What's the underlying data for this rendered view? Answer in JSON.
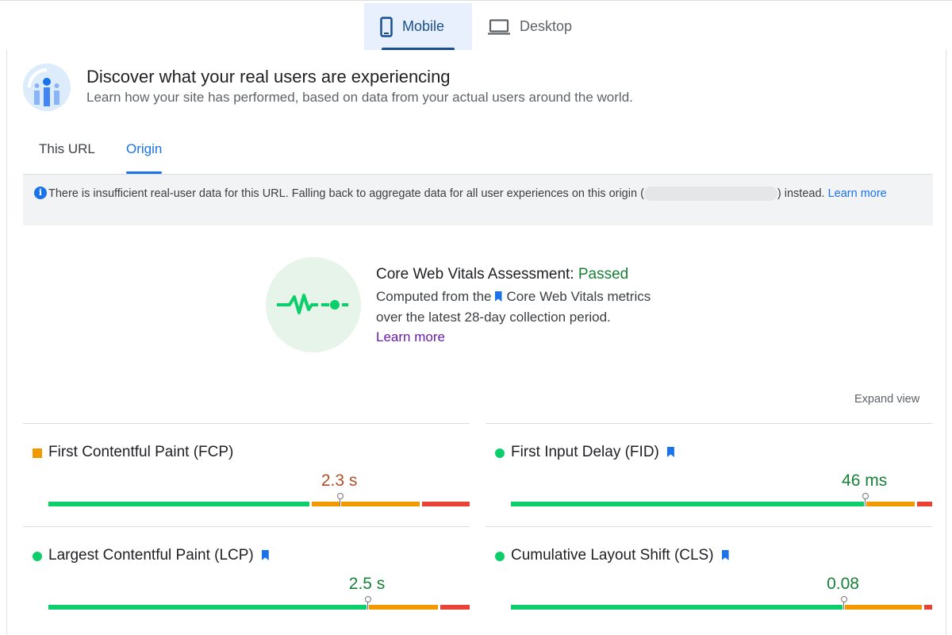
{
  "device_tabs": [
    {
      "label": "Mobile",
      "icon": "phone-icon",
      "active": true
    },
    {
      "label": "Desktop",
      "icon": "laptop-icon",
      "active": false
    }
  ],
  "hero": {
    "title": "Discover what your real users are experiencing",
    "subtitle": "Learn how your site has performed, based on data from your actual users around the world."
  },
  "scope_tabs": [
    {
      "label": "This URL",
      "active": false
    },
    {
      "label": "Origin",
      "active": true
    }
  ],
  "notice": {
    "text_before": "There is insufficient real-user data for this URL. Falling back to aggregate data for all user experiences on this origin (",
    "text_after": ") instead. ",
    "link": "Learn more"
  },
  "assessment": {
    "title": "Core Web Vitals Assessment: ",
    "status": "Passed",
    "line1_before": "Computed from the",
    "line1_after": "Core Web Vitals metrics",
    "line2": "over the latest 28-day collection period.",
    "learn_more": "Learn more"
  },
  "expand_view": "Expand view",
  "metrics": [
    {
      "key": "fcp",
      "name": "First Contentful Paint (FCP)",
      "value": "2.3 s",
      "marker": "square",
      "core_vital": false,
      "value_color": "#b0502a",
      "distribution": {
        "good": 0.625,
        "average": 0.262,
        "poor": 0.113
      },
      "pin": 0.75
    },
    {
      "key": "fid",
      "name": "First Input Delay (FID)",
      "value": "46 ms",
      "marker": "circle",
      "core_vital": true,
      "value_color": "#188038",
      "distribution": {
        "good": 0.843,
        "average": 0.121,
        "poor": 0.036
      },
      "pin": 0.75
    },
    {
      "key": "lcp",
      "name": "Largest Contentful Paint (LCP)",
      "value": "2.5 s",
      "marker": "circle",
      "core_vital": true,
      "value_color": "#188038",
      "distribution": {
        "good": 0.76,
        "average": 0.17,
        "poor": 0.07
      },
      "pin": 0.75
    },
    {
      "key": "cls",
      "name": "Cumulative Layout Shift (CLS)",
      "value": "0.08",
      "marker": "circle",
      "core_vital": true,
      "value_color": "#188038",
      "distribution": {
        "good": 0.792,
        "average": 0.19,
        "poor": 0.018
      },
      "pin": 0.75
    }
  ],
  "colors": {
    "good": "#0cce6b",
    "average": "#f29900",
    "poor": "#ea4335",
    "accent": "#1a73e8"
  }
}
